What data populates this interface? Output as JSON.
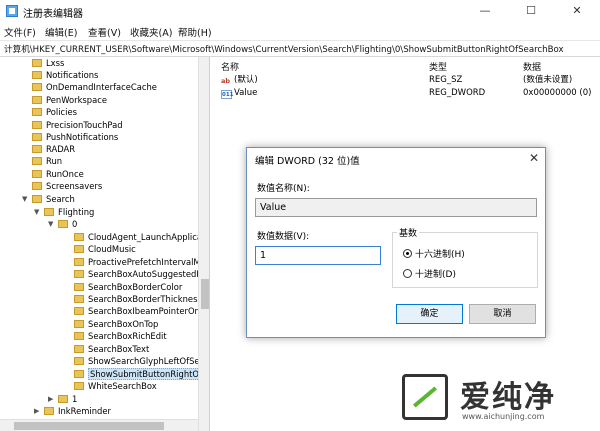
{
  "window": {
    "title": "注册表编辑器",
    "minimize_icon": "—",
    "maximize_icon": "☐",
    "close_icon": "✕"
  },
  "menu": [
    "文件(F)",
    "编辑(E)",
    "查看(V)",
    "收藏夹(A)",
    "帮助(H)"
  ],
  "address": "计算机\\HKEY_CURRENT_USER\\Software\\Microsoft\\Windows\\CurrentVersion\\Search\\Flighting\\0\\ShowSubmitButtonRightOfSearchBox",
  "tree": {
    "items": [
      "Lxss",
      "Notifications",
      "OnDemandInterfaceCache",
      "PenWorkspace",
      "Policies",
      "PrecisionTouchPad",
      "PushNotifications",
      "RADAR",
      "Run",
      "RunOnce",
      "Screensavers",
      "Search",
      "Flighting",
      "0",
      "CloudAgent_LaunchApplicati",
      "CloudMusic",
      "ProactivePrefetchIntervalMin",
      "SearchBoxAutoSuggestedFo",
      "SearchBoxBorderColor",
      "SearchBoxBorderThickness",
      "SearchBoxIbeamPointerOnH",
      "SearchBoxOnTop",
      "SearchBoxRichEdit",
      "SearchBoxText",
      "ShowSearchGlyphLeftOfSear",
      "ShowSubmitButtonRightOfSe",
      "WhiteSearchBox",
      "1",
      "InkReminder"
    ]
  },
  "values": {
    "headers": [
      "名称",
      "类型",
      "数据"
    ],
    "rows": [
      {
        "name": "(默认)",
        "type": "REG_SZ",
        "data": "(数值未设置)",
        "icon": "ab"
      },
      {
        "name": "Value",
        "type": "REG_DWORD",
        "data": "0x00000000 (0)",
        "icon": "bin"
      }
    ]
  },
  "dialog": {
    "title": "编辑 DWORD (32 位)值",
    "name_label": "数值名称(N):",
    "name_value": "Value",
    "data_label": "数值数据(V):",
    "data_value": "1",
    "base_label": "基数",
    "radio_hex": "十六进制(H)",
    "radio_dec": "十进制(D)",
    "ok": "确定",
    "cancel": "取消"
  },
  "watermark": {
    "text": "爱纯净",
    "url": "www.aichunjing.com"
  }
}
